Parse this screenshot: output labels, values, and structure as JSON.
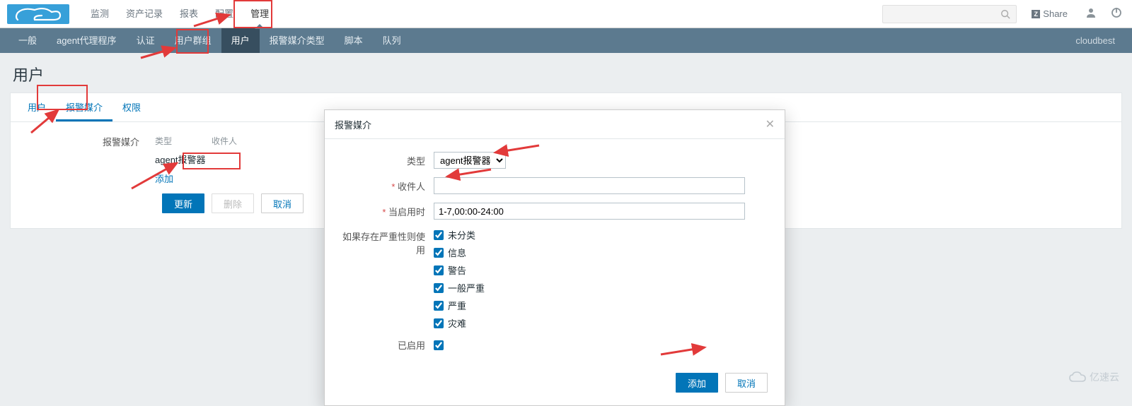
{
  "topnav": {
    "items": [
      "监测",
      "资产记录",
      "报表",
      "配置",
      "管理"
    ],
    "selected_index": 4,
    "share_label": "Share"
  },
  "subnav": {
    "items": [
      "一般",
      "agent代理程序",
      "认证",
      "用户群组",
      "用户",
      "报警媒介类型",
      "脚本",
      "队列"
    ],
    "selected_index": 4,
    "brand": "cloudbest"
  },
  "page": {
    "title": "用户"
  },
  "panel_tabs": {
    "items": [
      "用户",
      "报警媒介",
      "权限"
    ],
    "selected_index": 1
  },
  "media": {
    "section_label": "报警媒介",
    "head_type": "类型",
    "head_recipient": "收件人",
    "row1_type": "agent报警器",
    "add_link": "添加"
  },
  "actions": {
    "update": "更新",
    "delete": "删除",
    "cancel": "取消"
  },
  "modal": {
    "title": "报警媒介",
    "label_type": "类型",
    "type_value": "agent报警器",
    "label_recipient": "收件人",
    "recipient_value": "",
    "label_when": "当启用时",
    "when_value": "1-7,00:00-24:00",
    "label_severity": "如果存在严重性则使用",
    "severities": [
      "未分类",
      "信息",
      "警告",
      "一般严重",
      "严重",
      "灾难"
    ],
    "label_enabled": "已启用",
    "btn_add": "添加",
    "btn_cancel": "取消"
  },
  "watermark": "亿速云"
}
